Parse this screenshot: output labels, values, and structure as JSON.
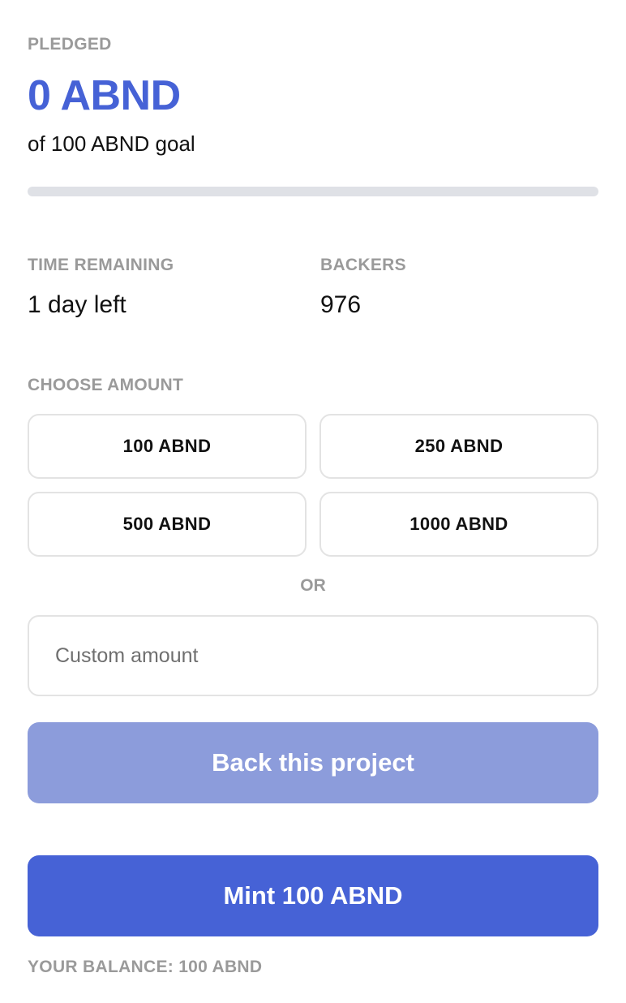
{
  "pledged": {
    "label": "PLEDGED",
    "amount": "0 ABND",
    "goal_text": "of 100 ABND goal",
    "progress_fraction": 0
  },
  "stats": {
    "time_label": "TIME REMAINING",
    "time_value": "1 day left",
    "backers_label": "BACKERS",
    "backers_value": "976"
  },
  "choose": {
    "label": "CHOOSE AMOUNT",
    "options": [
      "100 ABND",
      "250 ABND",
      "500 ABND",
      "1000 ABND"
    ],
    "or_text": "OR",
    "custom_placeholder": "Custom amount",
    "custom_value": ""
  },
  "actions": {
    "back_label": "Back this project",
    "mint_label": "Mint 100 ABND"
  },
  "balance": {
    "text": "YOUR BALANCE: 100 ABND"
  },
  "colors": {
    "accent": "#4662d6",
    "accent_disabled": "#8c9cdb",
    "muted_label": "#9a9a9a",
    "progress_track": "#dfe1e6"
  }
}
